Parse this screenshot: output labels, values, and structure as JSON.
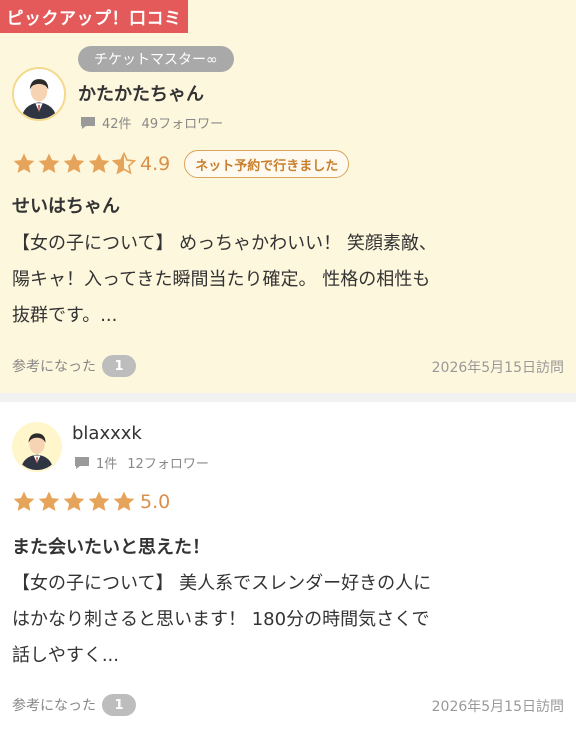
{
  "pickup_label": "ピックアップ！口コミ",
  "colors": {
    "pickup_tag": "#e45a5a",
    "card_highlight": "#fdf7dd",
    "star": "#e6a45a",
    "score": "#d9904a",
    "reserve_badge_border": "#d9a55d"
  },
  "reviews": [
    {
      "user_badge": "チケットマスター∞",
      "username": "かたかたちゃん",
      "comment_count": "42件",
      "followers": "49フォロワー",
      "rating": 4.5,
      "score": "4.9",
      "reservation_badge": "ネット予約で行きました",
      "title": "せいはちゃん",
      "body_lines": [
        "【女の子について】 めっちゃかわいい！ 笑顔素敵、",
        "陽キャ！入ってきた瞬間当たり確定。 性格の相性も",
        "抜群です。..."
      ],
      "helpful_label": "参考になった",
      "helpful_count": "1",
      "visit_date": "2026年5月15日訪問",
      "icons": {
        "avatar": "user-avatar-icon",
        "comment": "comment-icon",
        "star": "star-icon"
      }
    },
    {
      "username": "blaxxxk",
      "comment_count": "1件",
      "followers": "12フォロワー",
      "rating": 5,
      "score": "5.0",
      "title": "また会いたいと思えた！",
      "body_lines": [
        "【女の子について】 美人系でスレンダー好きの人に",
        "はかなり刺さると思います！ 180分の時間気さくで",
        "話しやすく..."
      ],
      "helpful_label": "参考になった",
      "helpful_count": "1",
      "visit_date": "2026年5月15日訪問",
      "icons": {
        "avatar": "user-avatar-icon",
        "comment": "comment-icon",
        "star": "star-icon"
      }
    }
  ]
}
